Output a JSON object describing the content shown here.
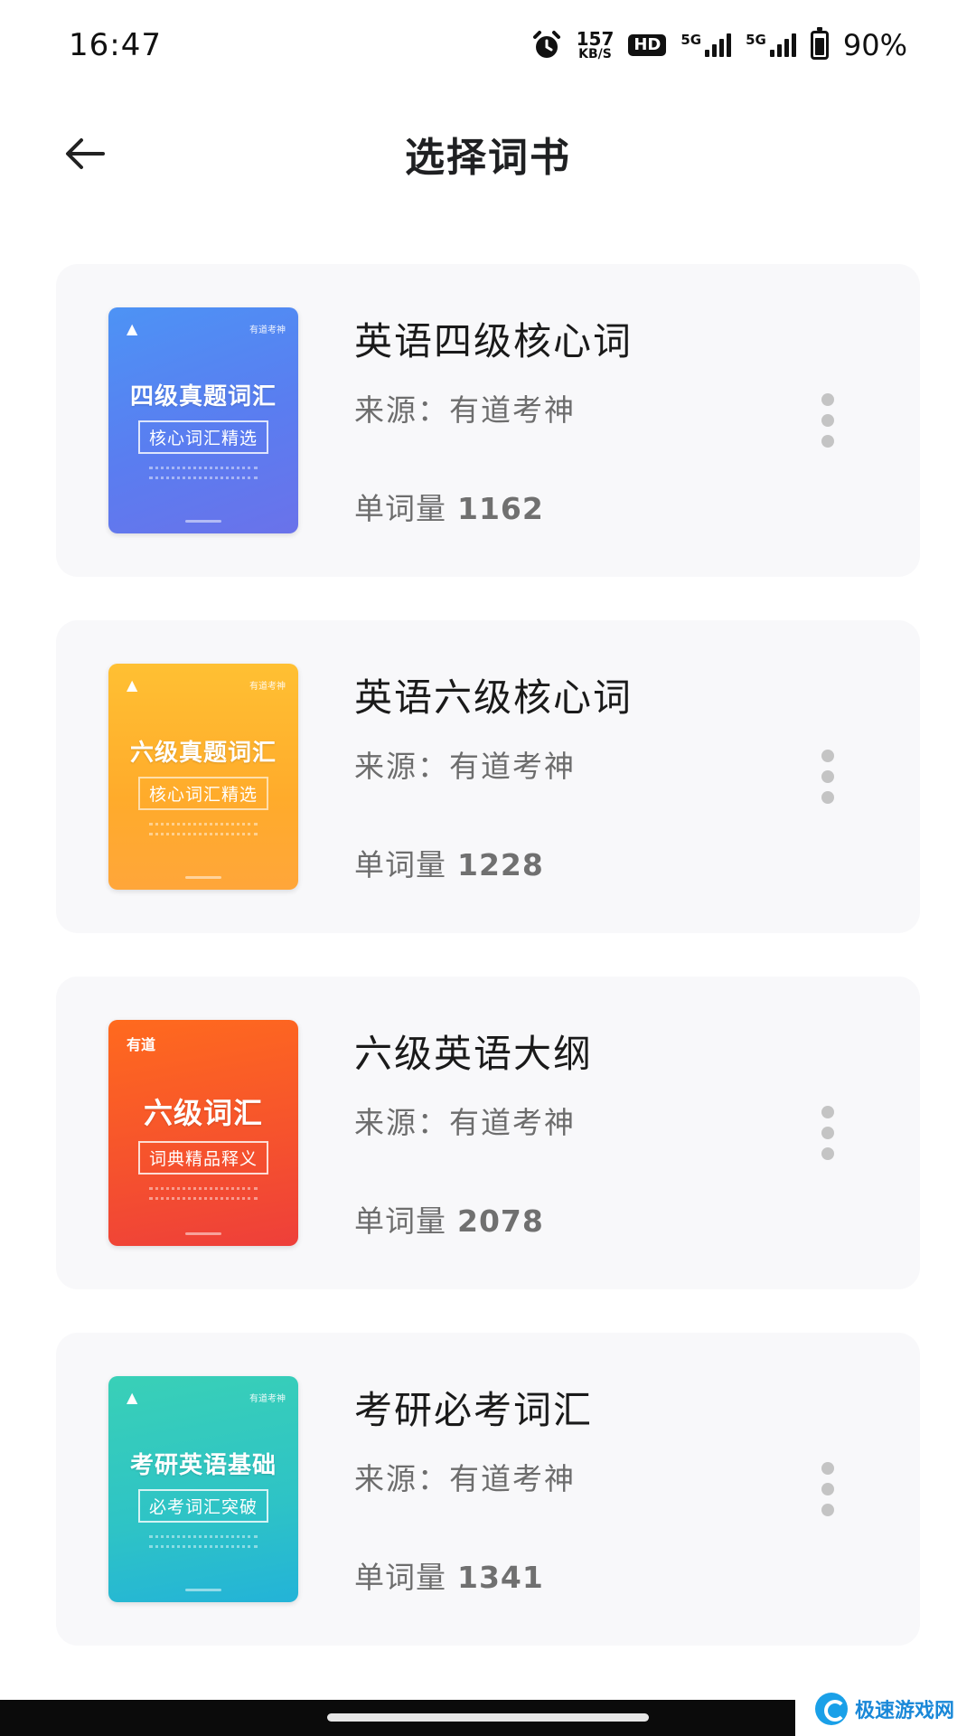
{
  "status_bar": {
    "time": "16:47",
    "speed_value": "157",
    "speed_unit": "KB/S",
    "hd_label": "HD",
    "net1_label": "5G",
    "net2_label": "5G",
    "battery": "90%"
  },
  "header": {
    "title": "选择词书"
  },
  "books": [
    {
      "title": "英语四级核心词",
      "source": "来源：有道考神",
      "count_label": "单词量",
      "count": "1162",
      "cover": {
        "title": "四级真题词汇",
        "subtitle": "核心词汇精选",
        "brand": "有道考神",
        "color": "#5a7df0"
      }
    },
    {
      "title": "英语六级核心词",
      "source": "来源：有道考神",
      "count_label": "单词量",
      "count": "1228",
      "cover": {
        "title": "六级真题词汇",
        "subtitle": "核心词汇精选",
        "brand": "有道考神",
        "color": "#ffab2b"
      }
    },
    {
      "title": "六级英语大纲",
      "source": "来源：有道考神",
      "count_label": "单词量",
      "count": "2078",
      "cover": {
        "title": "六级词汇",
        "subtitle": "词典精品释义",
        "brand": "有道",
        "color": "#f5512e"
      }
    },
    {
      "title": "考研必考词汇",
      "source": "来源：有道考神",
      "count_label": "单词量",
      "count": "1341",
      "cover": {
        "title": "考研英语基础",
        "subtitle": "必考词汇突破",
        "brand": "有道考神",
        "color": "#2ec3c6"
      }
    }
  ],
  "watermark": {
    "text": "极速游戏网"
  }
}
